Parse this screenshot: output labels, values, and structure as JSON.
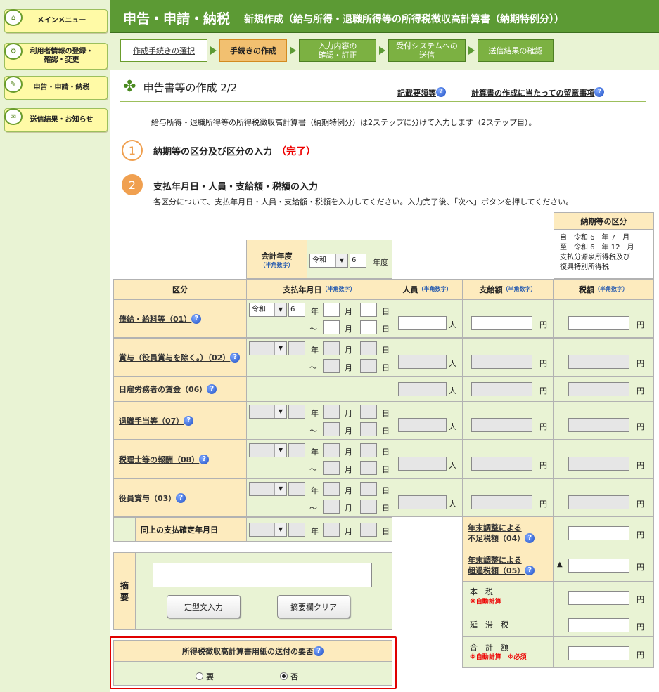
{
  "sidebar": {
    "items": [
      "メインメニュー",
      "利用者情報の登録・\n確認・変更",
      "申告・申請・納税",
      "送信結果・お知らせ"
    ]
  },
  "header": {
    "title": "申告・申請・納税",
    "subtitle": "新規作成（給与所得・退職所得等の所得税徴収高計算書（納期特例分））"
  },
  "steps": [
    "作成手続きの選択",
    "手続きの作成",
    "入力内容の\n確認・訂正",
    "受付システムへの\n送信",
    "送信結果の確認"
  ],
  "page": {
    "heading": "申告書等の作成 2/2",
    "link1": "記載要領等",
    "link2": "計算書の作成に当たっての留意事項",
    "intro": "給与所得・退職所得等の所得税徴収高計算書（納期特例分）は2ステップに分けて入力します（2ステップ目）。"
  },
  "step_items": [
    {
      "num": "1",
      "label": "納期等の区分及び区分の入力",
      "status": "（完了）"
    },
    {
      "num": "2",
      "label": "支払年月日・人員・支給額・税額の入力",
      "desc": "各区分について、支払年月日・人員・支給額・税額を入力してください。入力完了後、「次へ」ボタンを押してください。"
    }
  ],
  "period": {
    "title": "納期等の区分",
    "from": "自　令和 6　年 7　月",
    "to": "至　令和 6　年 12　月",
    "desc": "支払分源泉所得税及び\n復興特別所得税"
  },
  "fiscal": {
    "label": "会計年度",
    "hint": "（半角数字）",
    "era": "令和",
    "year": "6",
    "unit": "年度"
  },
  "cols": {
    "kubun": "区分",
    "date": "支払年月日",
    "date_hint": "（半角数字）",
    "jinin": "人員",
    "jinin_hint": "（半角数字）",
    "shikyu": "支給額",
    "shikyu_hint": "（半角数字）",
    "zeigaku": "税額",
    "zeigaku_hint": "（半角数字）"
  },
  "units": {
    "year": "年",
    "month": "月",
    "day": "日",
    "tilde": "～",
    "person": "人",
    "yen": "円"
  },
  "rows": [
    {
      "label": "俸給・給料等（01）",
      "era": "令和",
      "year": "6"
    },
    {
      "label": "賞与（役員賞与を除く。）（02）",
      "era": "",
      "year": ""
    },
    {
      "label": "日雇労務者の賃金（06）"
    },
    {
      "label": "退職手当等（07）"
    },
    {
      "label": "税理士等の報酬（08）"
    },
    {
      "label": "役員賞与（03）"
    }
  ],
  "confirm_date": "同上の支払確定年月日",
  "right_rows": {
    "r04": "年末調整による\n不足税額（04）",
    "r05": "年末調整による\n超過税額（05）",
    "triangle": "▲",
    "honzei": "本　税",
    "auto": "※自動計算",
    "entai": "延　滞　税",
    "gokei": "合　計　額",
    "required": "※必須"
  },
  "tekiyo": {
    "label": "摘\n要",
    "btn1": "定型文入力",
    "btn2": "摘要欄クリア"
  },
  "send": {
    "question": "所得税徴収高計算書用紙の送付の要否",
    "yes": "要",
    "no": "否",
    "selected": "否"
  },
  "colors": {
    "green": "#5c9a34",
    "tan": "#fdebbe",
    "highlight": "#e00000"
  }
}
